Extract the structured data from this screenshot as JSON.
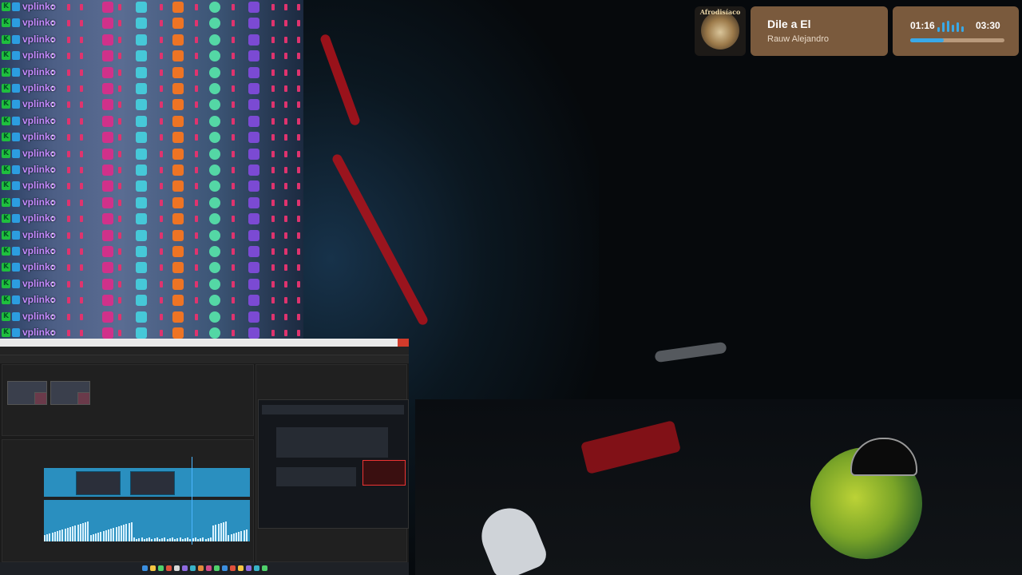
{
  "chat": {
    "username": "vplinko",
    "separator": ":",
    "badge_letter": "K",
    "row_count": 21,
    "emote_sequence": [
      "pink",
      "blue",
      "orange",
      "green",
      "purple"
    ]
  },
  "music": {
    "album_art_text": "Afrodisíaco",
    "title": "Dile a El",
    "artist": "Rauw Alejandro",
    "elapsed": "01:16",
    "duration": "03:30",
    "progress": 0.36
  },
  "colors": {
    "widget_bg": "#7a5a3d",
    "accent": "#39a9e8",
    "username": "#c58bff"
  },
  "icons": [
    "music-bars-icon",
    "close-icon",
    "twitch-badge-icon"
  ]
}
